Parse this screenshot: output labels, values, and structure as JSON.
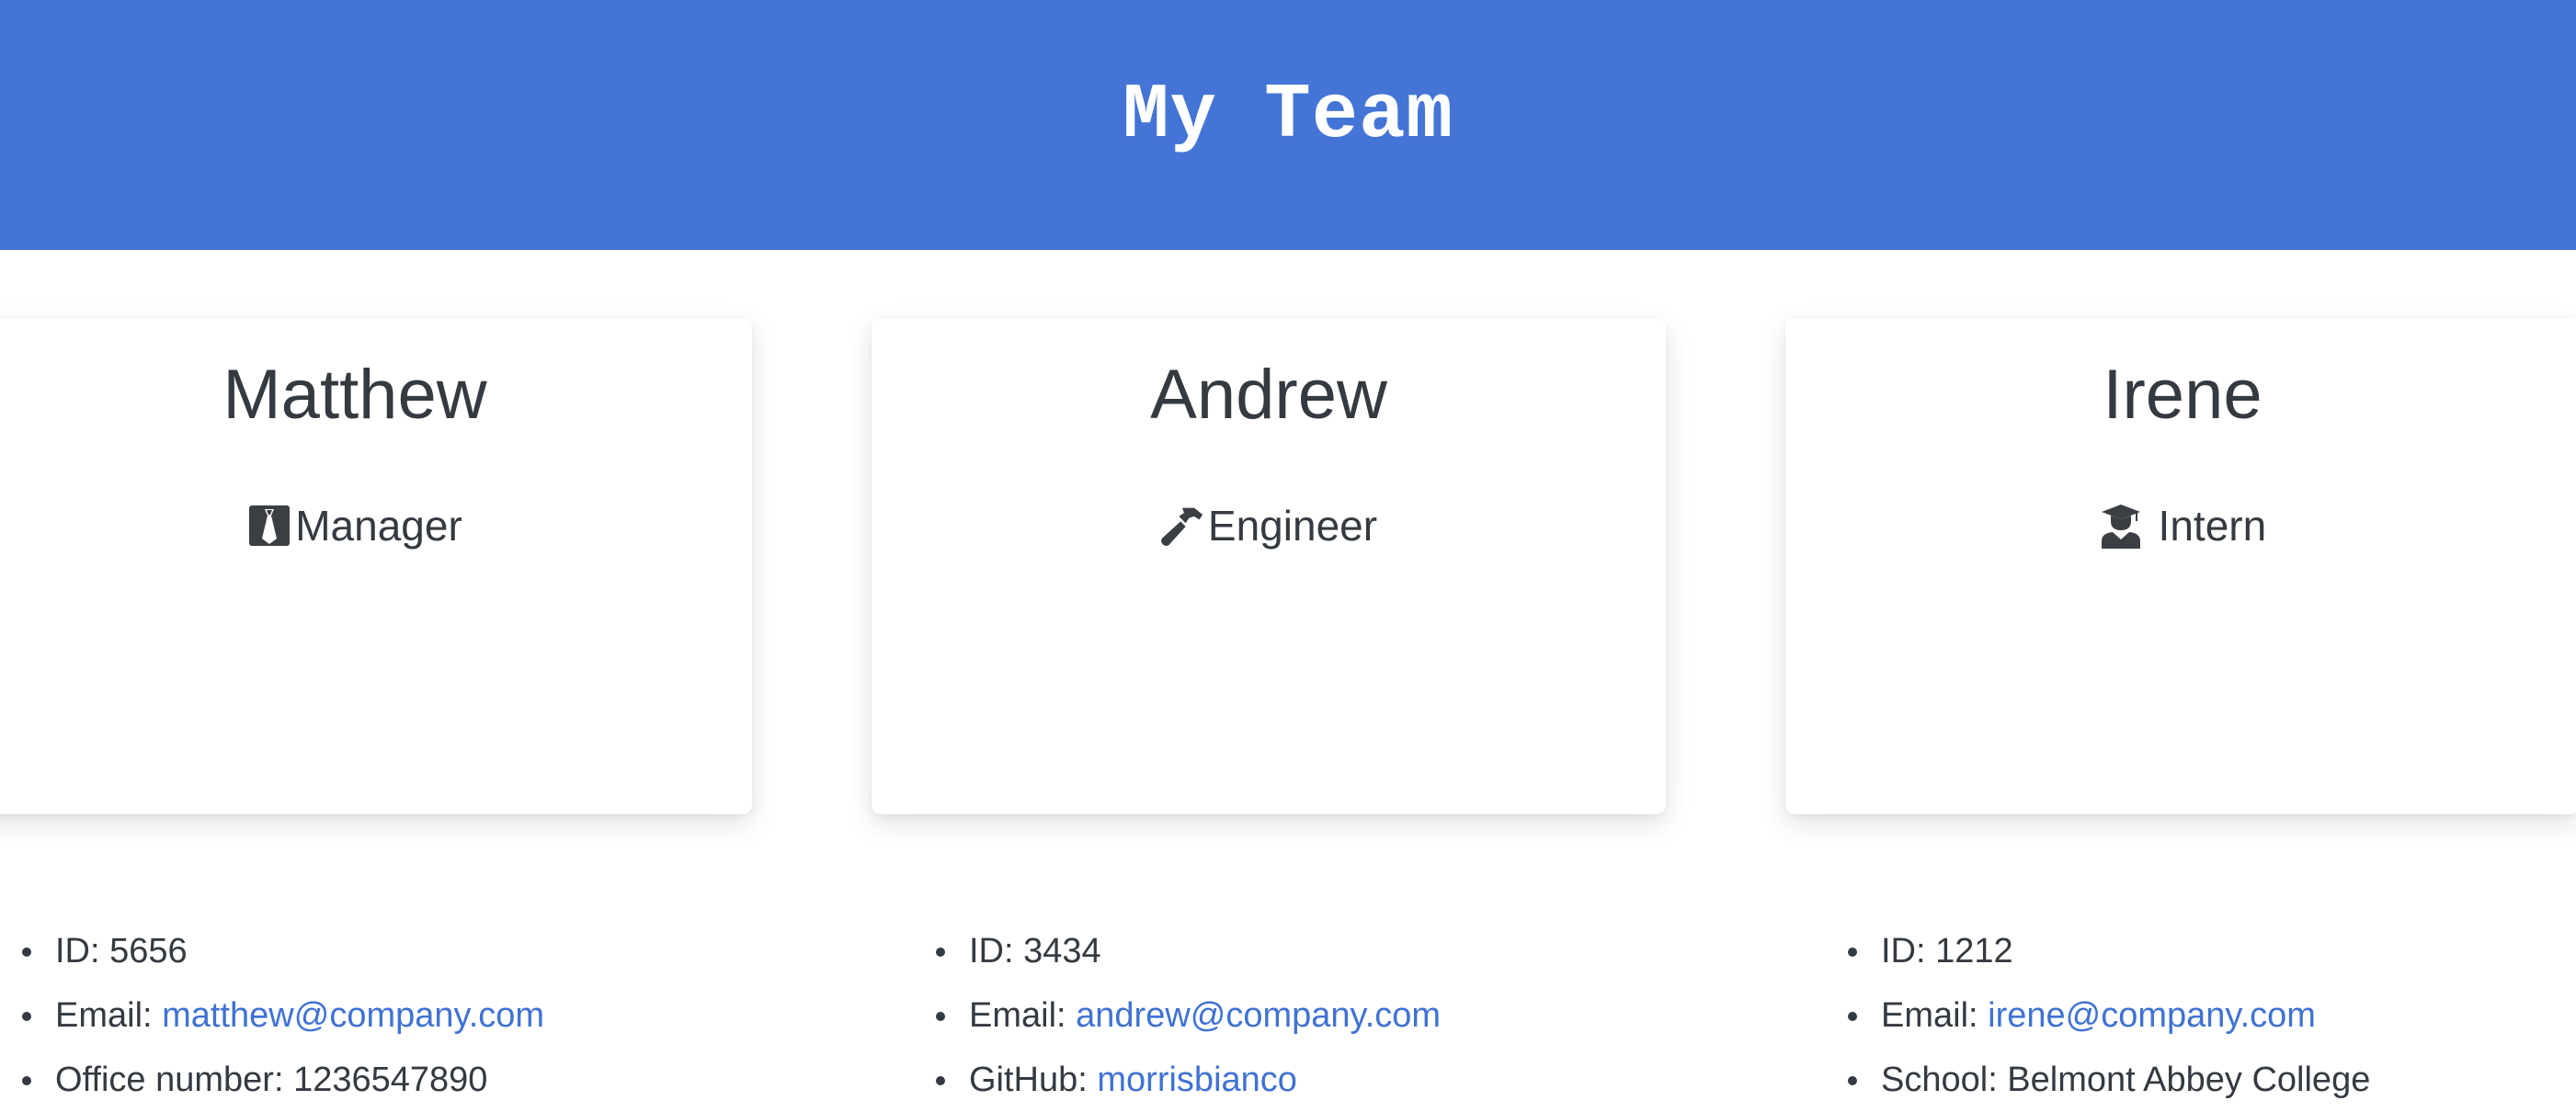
{
  "header": {
    "title": "My Team"
  },
  "team": [
    {
      "name": "Matthew",
      "role": "Manager",
      "role_icon": "tie-icon",
      "id_label": "ID: 5656",
      "email_label": "Email: ",
      "email": "matthew@company.com",
      "extra_label": "Office number: 1236547890",
      "extra_link": null
    },
    {
      "name": "Andrew",
      "role": "Engineer",
      "role_icon": "hammer-icon",
      "id_label": "ID: 3434",
      "email_label": "Email: ",
      "email": "andrew@company.com",
      "extra_label": "GitHub: ",
      "extra_link": "morrisbianco"
    },
    {
      "name": "Irene",
      "role": " Intern",
      "role_icon": "graduate-icon",
      "id_label": "ID: 1212",
      "email_label": "Email: ",
      "email": "irene@company.com",
      "extra_label": "School: Belmont Abbey College",
      "extra_link": null
    }
  ],
  "colors": {
    "header_bg": "#4474d6",
    "link": "#3f72d4",
    "text": "#343a40"
  }
}
